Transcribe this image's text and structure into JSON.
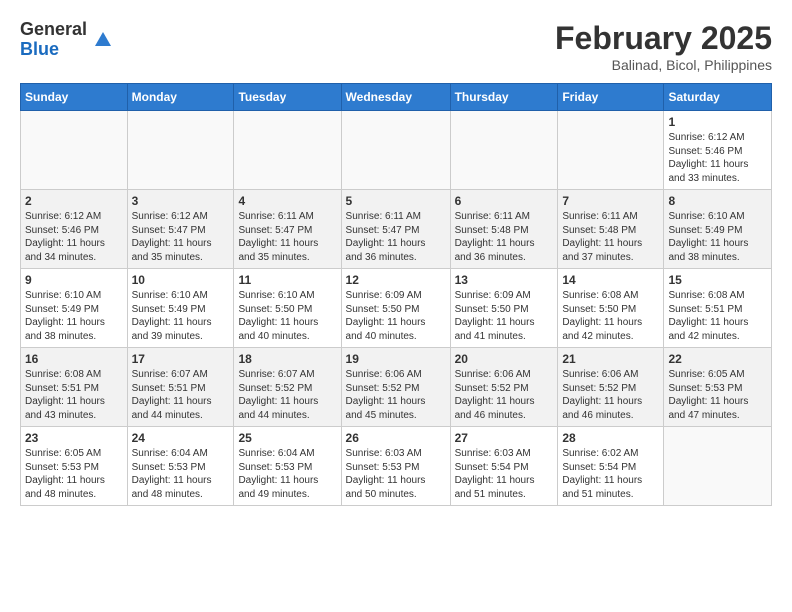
{
  "header": {
    "logo_general": "General",
    "logo_blue": "Blue",
    "month_year": "February 2025",
    "location": "Balinad, Bicol, Philippines"
  },
  "days_of_week": [
    "Sunday",
    "Monday",
    "Tuesday",
    "Wednesday",
    "Thursday",
    "Friday",
    "Saturday"
  ],
  "weeks": [
    [
      {
        "day": "",
        "info": ""
      },
      {
        "day": "",
        "info": ""
      },
      {
        "day": "",
        "info": ""
      },
      {
        "day": "",
        "info": ""
      },
      {
        "day": "",
        "info": ""
      },
      {
        "day": "",
        "info": ""
      },
      {
        "day": "1",
        "info": "Sunrise: 6:12 AM\nSunset: 5:46 PM\nDaylight: 11 hours\nand 33 minutes."
      }
    ],
    [
      {
        "day": "2",
        "info": "Sunrise: 6:12 AM\nSunset: 5:46 PM\nDaylight: 11 hours\nand 34 minutes."
      },
      {
        "day": "3",
        "info": "Sunrise: 6:12 AM\nSunset: 5:47 PM\nDaylight: 11 hours\nand 35 minutes."
      },
      {
        "day": "4",
        "info": "Sunrise: 6:11 AM\nSunset: 5:47 PM\nDaylight: 11 hours\nand 35 minutes."
      },
      {
        "day": "5",
        "info": "Sunrise: 6:11 AM\nSunset: 5:47 PM\nDaylight: 11 hours\nand 36 minutes."
      },
      {
        "day": "6",
        "info": "Sunrise: 6:11 AM\nSunset: 5:48 PM\nDaylight: 11 hours\nand 36 minutes."
      },
      {
        "day": "7",
        "info": "Sunrise: 6:11 AM\nSunset: 5:48 PM\nDaylight: 11 hours\nand 37 minutes."
      },
      {
        "day": "8",
        "info": "Sunrise: 6:10 AM\nSunset: 5:49 PM\nDaylight: 11 hours\nand 38 minutes."
      }
    ],
    [
      {
        "day": "9",
        "info": "Sunrise: 6:10 AM\nSunset: 5:49 PM\nDaylight: 11 hours\nand 38 minutes."
      },
      {
        "day": "10",
        "info": "Sunrise: 6:10 AM\nSunset: 5:49 PM\nDaylight: 11 hours\nand 39 minutes."
      },
      {
        "day": "11",
        "info": "Sunrise: 6:10 AM\nSunset: 5:50 PM\nDaylight: 11 hours\nand 40 minutes."
      },
      {
        "day": "12",
        "info": "Sunrise: 6:09 AM\nSunset: 5:50 PM\nDaylight: 11 hours\nand 40 minutes."
      },
      {
        "day": "13",
        "info": "Sunrise: 6:09 AM\nSunset: 5:50 PM\nDaylight: 11 hours\nand 41 minutes."
      },
      {
        "day": "14",
        "info": "Sunrise: 6:08 AM\nSunset: 5:50 PM\nDaylight: 11 hours\nand 42 minutes."
      },
      {
        "day": "15",
        "info": "Sunrise: 6:08 AM\nSunset: 5:51 PM\nDaylight: 11 hours\nand 42 minutes."
      }
    ],
    [
      {
        "day": "16",
        "info": "Sunrise: 6:08 AM\nSunset: 5:51 PM\nDaylight: 11 hours\nand 43 minutes."
      },
      {
        "day": "17",
        "info": "Sunrise: 6:07 AM\nSunset: 5:51 PM\nDaylight: 11 hours\nand 44 minutes."
      },
      {
        "day": "18",
        "info": "Sunrise: 6:07 AM\nSunset: 5:52 PM\nDaylight: 11 hours\nand 44 minutes."
      },
      {
        "day": "19",
        "info": "Sunrise: 6:06 AM\nSunset: 5:52 PM\nDaylight: 11 hours\nand 45 minutes."
      },
      {
        "day": "20",
        "info": "Sunrise: 6:06 AM\nSunset: 5:52 PM\nDaylight: 11 hours\nand 46 minutes."
      },
      {
        "day": "21",
        "info": "Sunrise: 6:06 AM\nSunset: 5:52 PM\nDaylight: 11 hours\nand 46 minutes."
      },
      {
        "day": "22",
        "info": "Sunrise: 6:05 AM\nSunset: 5:53 PM\nDaylight: 11 hours\nand 47 minutes."
      }
    ],
    [
      {
        "day": "23",
        "info": "Sunrise: 6:05 AM\nSunset: 5:53 PM\nDaylight: 11 hours\nand 48 minutes."
      },
      {
        "day": "24",
        "info": "Sunrise: 6:04 AM\nSunset: 5:53 PM\nDaylight: 11 hours\nand 48 minutes."
      },
      {
        "day": "25",
        "info": "Sunrise: 6:04 AM\nSunset: 5:53 PM\nDaylight: 11 hours\nand 49 minutes."
      },
      {
        "day": "26",
        "info": "Sunrise: 6:03 AM\nSunset: 5:53 PM\nDaylight: 11 hours\nand 50 minutes."
      },
      {
        "day": "27",
        "info": "Sunrise: 6:03 AM\nSunset: 5:54 PM\nDaylight: 11 hours\nand 51 minutes."
      },
      {
        "day": "28",
        "info": "Sunrise: 6:02 AM\nSunset: 5:54 PM\nDaylight: 11 hours\nand 51 minutes."
      },
      {
        "day": "",
        "info": ""
      }
    ]
  ]
}
